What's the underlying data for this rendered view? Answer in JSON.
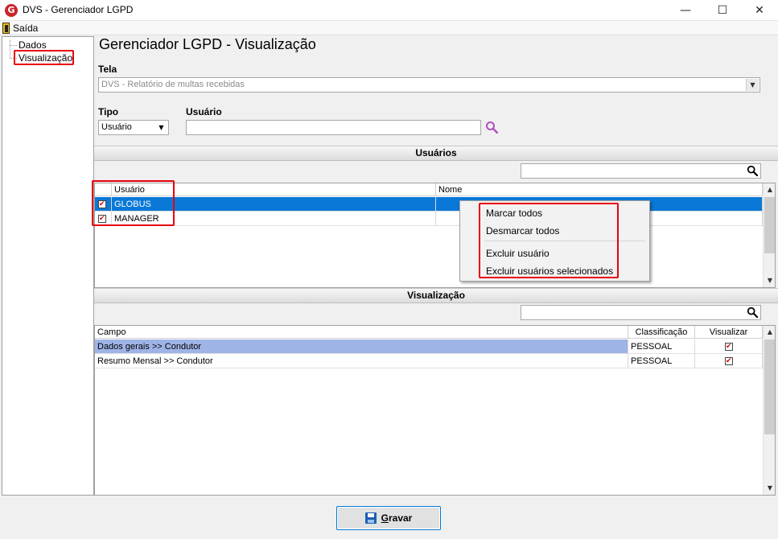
{
  "window": {
    "title": "DVS - Gerenciador LGPD",
    "controls": {
      "minimize": "—",
      "maximize": "☐",
      "close": "✕"
    }
  },
  "menu": {
    "exit_label": "Saída"
  },
  "tree": {
    "items": [
      {
        "label": "Dados"
      },
      {
        "label": "Visualização"
      }
    ]
  },
  "page": {
    "title": "Gerenciador LGPD - Visualização"
  },
  "tela": {
    "label": "Tela",
    "value": "DVS - Relatório de multas recebidas"
  },
  "tipo": {
    "label": "Tipo",
    "value": "Usuário"
  },
  "usuario_field": {
    "label": "Usuário",
    "value": ""
  },
  "usuarios_section": {
    "title": "Usuários",
    "columns": [
      "Usuário",
      "Nome"
    ],
    "rows": [
      {
        "usuario": "GLOBUS",
        "nome": "",
        "checked": true,
        "selected": true
      },
      {
        "usuario": "MANAGER",
        "nome": "",
        "checked": true,
        "selected": false
      }
    ]
  },
  "context_menu": {
    "items": [
      "Marcar todos",
      "Desmarcar todos",
      "Excluir usuário",
      "Excluir usuários selecionados"
    ]
  },
  "visualizacao_section": {
    "title": "Visualização",
    "columns": [
      "Campo",
      "Classificação",
      "Visualizar"
    ],
    "rows": [
      {
        "campo": "Dados gerais >> Condutor",
        "classificacao": "PESSOAL",
        "visualizar": true,
        "selected": true
      },
      {
        "campo": "Resumo Mensal >> Condutor",
        "classificacao": "PESSOAL",
        "visualizar": true,
        "selected": false
      }
    ]
  },
  "buttons": {
    "save_label": "Gravar"
  },
  "colors": {
    "highlight_red": "#e8000b",
    "selection_blue": "#0a78d7",
    "selection_lavender": "#9fb4e6",
    "search_icon": "#b050c0"
  }
}
